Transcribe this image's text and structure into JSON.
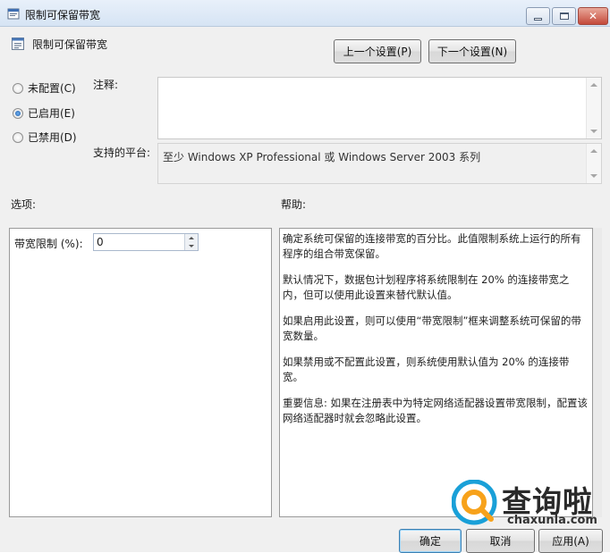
{
  "window": {
    "title": "限制可保留带宽",
    "close_glyph": "✕"
  },
  "header": {
    "policy_title": "限制可保留带宽",
    "prev_button": "上一个设置(P)",
    "next_button": "下一个设置(N)"
  },
  "state": {
    "options": [
      {
        "label": "未配置(C)",
        "checked": false
      },
      {
        "label": "已启用(E)",
        "checked": true
      },
      {
        "label": "已禁用(D)",
        "checked": false
      }
    ]
  },
  "comment": {
    "label": "注释:",
    "value": ""
  },
  "platform": {
    "label": "支持的平台:",
    "value": "至少 Windows XP Professional 或 Windows Server 2003 系列"
  },
  "options_section": {
    "heading": "选项:",
    "bandwidth_label": "带宽限制 (%):",
    "bandwidth_value": "0"
  },
  "help_section": {
    "heading": "帮助:",
    "paragraphs": [
      "确定系统可保留的连接带宽的百分比。此值限制系统上运行的所有程序的组合带宽保留。",
      "默认情况下，数据包计划程序将系统限制在 20% 的连接带宽之内，但可以使用此设置来替代默认值。",
      "如果启用此设置，则可以使用“带宽限制”框来调整系统可保留的带宽数量。",
      "如果禁用或不配置此设置，则系统使用默认值为 20% 的连接带宽。",
      "重要信息: 如果在注册表中为特定网络适配器设置带宽限制，配置该网络适配器时就会忽略此设置。"
    ]
  },
  "footer": {
    "ok": "确定",
    "cancel": "取消",
    "apply": "应用(A)"
  },
  "watermark": {
    "cn": "查询啦",
    "en": "chaxunla.com"
  }
}
